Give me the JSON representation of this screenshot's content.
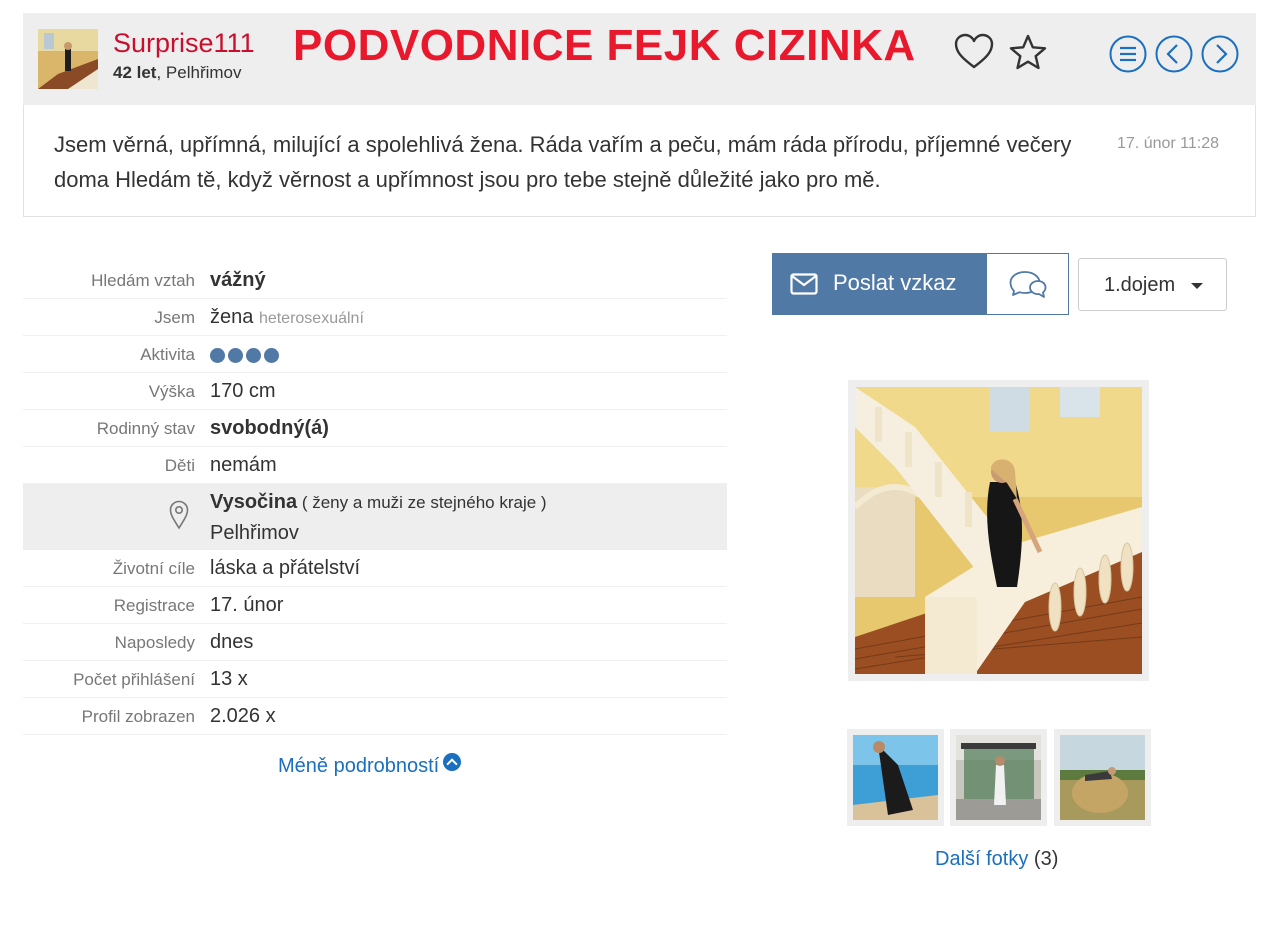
{
  "profile": {
    "username": "Surprise111",
    "age": "42 let",
    "city": ", Pelhřimov",
    "warning": "PODVODNICE FEJK CIZINKA"
  },
  "header_icons": [
    "heart-icon",
    "star-icon",
    "menu-icon",
    "chevron-left-icon",
    "chevron-right-icon"
  ],
  "intro": {
    "text": "Jsem věrná, upřímná, milující a spolehlivá žena. Ráda vařím a peču, mám ráda přírodu, příjemné večery doma Hledám tě, když věrnost a upřímnost jsou pro tebe stejně důležité jako pro mě.",
    "time": "17. únor 11:28"
  },
  "details": {
    "looking_for": {
      "label": "Hledám vztah",
      "value": "vážný"
    },
    "am": {
      "label": "Jsem",
      "value": "žena",
      "sub": "heterosexuální"
    },
    "activity": {
      "label": "Aktivita",
      "level": 4,
      "max": 4
    },
    "height": {
      "label": "Výška",
      "value": "170 cm"
    },
    "marital": {
      "label": "Rodinný stav",
      "value": "svobodný(á)"
    },
    "children": {
      "label": "Děti",
      "value": "nemám"
    },
    "location": {
      "region": "Vysočina",
      "open_paren": " ( ",
      "women_link": "ženy",
      "and": " a ",
      "men_link": "muži",
      "suffix": " ze stejného kraje )",
      "city": "Pelhřimov"
    },
    "goals": {
      "label": "Životní cíle",
      "value": "láska a přátelství"
    },
    "registration": {
      "label": "Registrace",
      "value": "17. únor"
    },
    "last_seen": {
      "label": "Naposledy",
      "value": "dnes"
    },
    "logins": {
      "label": "Počet přihlášení",
      "value": "13 x"
    },
    "views": {
      "label": "Profil zobrazen",
      "value": "2.026 x"
    },
    "less_link": "Méně podrobností"
  },
  "actions": {
    "send_label": "Poslat vzkaz",
    "impression_label": "1.dojem"
  },
  "photos": {
    "more_label": "Další fotky",
    "more_count": " (3)"
  },
  "colors": {
    "username": "#c8102e",
    "warning": "#e8192c",
    "accent": "#5179a6",
    "link": "#1a6fc1"
  }
}
